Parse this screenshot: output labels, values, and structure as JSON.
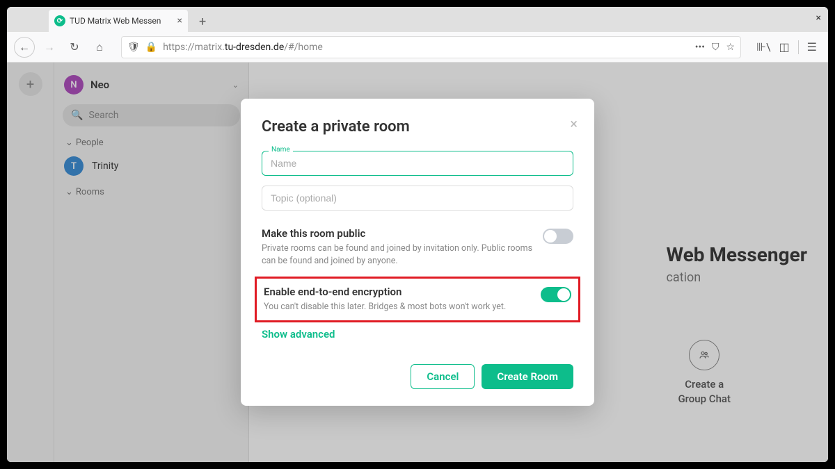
{
  "browser": {
    "tab_title": "TUD Matrix Web Messen",
    "url_secure_prefix": "https://matrix.",
    "url_host": "tu-dresden.de",
    "url_path": "/#/home"
  },
  "sidebar": {
    "user_initial": "N",
    "user_name": "Neo",
    "search_placeholder": "Search",
    "sections": {
      "people": "People",
      "rooms": "Rooms"
    },
    "people": [
      {
        "initial": "T",
        "name": "Trinity"
      }
    ]
  },
  "background": {
    "title_fragment": "Web Messenger",
    "subtitle_fragment": "cation",
    "action_line1": "Create a",
    "action_line2": "Group Chat"
  },
  "modal": {
    "title": "Create a private room",
    "name_label": "Name",
    "name_placeholder": "Name",
    "topic_placeholder": "Topic (optional)",
    "make_public": {
      "title": "Make this room public",
      "desc": "Private rooms can be found and joined by invitation only. Public rooms can be found and joined by anyone.",
      "value": false
    },
    "e2e": {
      "title": "Enable end-to-end encryption",
      "desc": "You can't disable this later. Bridges & most bots won't work yet.",
      "value": true
    },
    "show_advanced": "Show advanced",
    "cancel": "Cancel",
    "create": "Create Room"
  }
}
